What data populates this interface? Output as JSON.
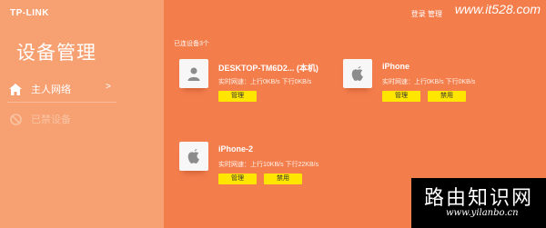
{
  "header": {
    "logo": "TP-LINK",
    "top_link": "登录 管理",
    "watermark_url": "www.it528.com"
  },
  "sidebar": {
    "title": "设备管理",
    "items": [
      {
        "label": "主人网络",
        "icon": "home-icon",
        "active": true
      },
      {
        "label": "已禁设备",
        "icon": "ban-icon",
        "active": false
      }
    ]
  },
  "main": {
    "count_label": "已连设备3个",
    "devices": [
      {
        "name": "DESKTOP-TM6D2... (本机)",
        "icon": "user-icon",
        "speed": "实时网速：上行0KB/s  下行0KB/s",
        "manage_label": "管理"
      },
      {
        "name": "iPhone",
        "icon": "apple-icon",
        "speed": "实时网速：上行0KB/s  下行0KB/s",
        "manage_label": "管理",
        "ban_label": "禁用"
      },
      {
        "name": "iPhone-2",
        "icon": "apple-icon",
        "speed": "实时网速：上行10KB/s  下行22KB/s",
        "manage_label": "管理",
        "ban_label": "禁用"
      }
    ]
  },
  "brand": {
    "name": "路由知识网",
    "url": "www.yilanbo.cn"
  },
  "colors": {
    "background": "#f47d4c",
    "sidebar": "#f7a072",
    "button": "#ffe600"
  }
}
